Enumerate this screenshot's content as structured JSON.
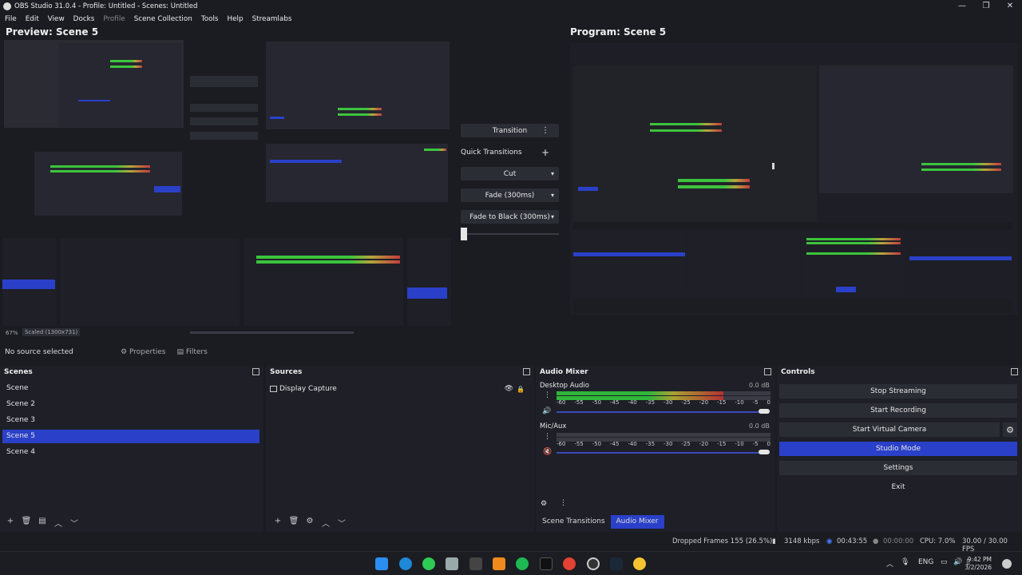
{
  "window": {
    "title": "OBS Studio 31.0.4 - Profile: Untitled - Scenes: Untitled",
    "controls": [
      "—",
      "❐",
      "✕"
    ]
  },
  "menu": [
    "File",
    "Edit",
    "View",
    "Docks",
    "Profile",
    "Scene Collection",
    "Tools",
    "Help",
    "Streamlabs"
  ],
  "preview": {
    "label": "Preview: Scene 5",
    "zoom": "67%",
    "scale": "Scaled (1300x731)"
  },
  "program": {
    "label": "Program: Scene 5"
  },
  "transition": {
    "title": "Transition",
    "quick": "Quick Transitions",
    "cut": "Cut",
    "fade": "Fade (300ms)",
    "fade_black": "Fade to Black (300ms)",
    "add": "+",
    "menu": "⋮"
  },
  "source_toolbar": {
    "no_source": "No source selected",
    "properties": "Properties",
    "filters": "Filters"
  },
  "scenes": {
    "title": "Scenes",
    "items": [
      "Scene",
      "Scene 2",
      "Scene 3",
      "Scene 5",
      "Scene 4"
    ],
    "selected": "Scene 5"
  },
  "sources": {
    "title": "Sources",
    "items": [
      "Display Capture"
    ]
  },
  "mixer": {
    "title": "Audio Mixer",
    "channels": [
      {
        "name": "Desktop Audio",
        "db": "0.0 dB",
        "level": 0.78
      },
      {
        "name": "Mic/Aux",
        "db": "0.0 dB",
        "level": 0.0
      }
    ],
    "scale": [
      "-60",
      "-55",
      "-50",
      "-45",
      "-40",
      "-35",
      "-30",
      "-25",
      "-20",
      "-15",
      "-10",
      "-5",
      "0"
    ]
  },
  "dock_tabs": [
    "Scene Transitions",
    "Audio Mixer"
  ],
  "controls": {
    "title": "Controls",
    "buttons": [
      "Stop Streaming",
      "Start Recording",
      "Start Virtual Camera",
      "Studio Mode",
      "Settings",
      "Exit"
    ],
    "selected": "Studio Mode"
  },
  "status": {
    "dropped": "Dropped Frames 155 (26.5%)",
    "bitrate": "3148 kbps",
    "stream_time": "00:43:55",
    "rec_time": "00:00:00",
    "cpu": "CPU: 7.0%",
    "fps": "30.00 / 30.00 FPS"
  },
  "taskbar": {
    "lang": "ENG",
    "time": "9:42 PM",
    "date": "3/2/2026"
  },
  "colors": {
    "accent": "#2a40c8",
    "bg": "#1b1c22",
    "panel": "#1e1f27",
    "button": "#2b2d35"
  }
}
